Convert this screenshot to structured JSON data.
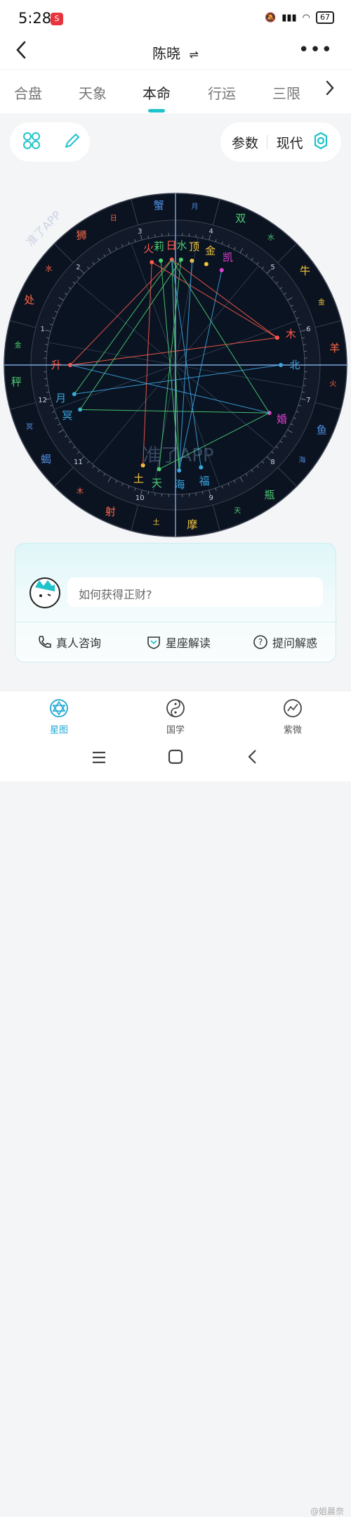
{
  "status": {
    "time": "5:28",
    "battery": "67",
    "app_badge": "S"
  },
  "header": {
    "title": "陈晓",
    "swap_icon": "⇌"
  },
  "tabs": [
    {
      "label": "合盘"
    },
    {
      "label": "天象"
    },
    {
      "label": "本命"
    },
    {
      "label": "行运"
    },
    {
      "label": "三限"
    }
  ],
  "toolbar": {
    "params_label": "参数",
    "mode_label": "现代"
  },
  "chart": {
    "watermark": "准了APP",
    "accent": "#21c3cb",
    "signs": [
      {
        "name": "蟹",
        "ruler": "月"
      },
      {
        "name": "狮",
        "ruler": "日"
      },
      {
        "name": "处",
        "ruler": "水"
      },
      {
        "name": "秤",
        "ruler": "金"
      },
      {
        "name": "蝎",
        "ruler": "冥"
      },
      {
        "name": "射",
        "ruler": "木"
      },
      {
        "name": "摩",
        "ruler": "土"
      },
      {
        "name": "瓶",
        "ruler": "天"
      },
      {
        "name": "鱼",
        "ruler": "海"
      },
      {
        "name": "羊",
        "ruler": "火"
      },
      {
        "name": "牛",
        "ruler": "金"
      },
      {
        "name": "双",
        "ruler": "水"
      }
    ],
    "houses": [
      "1",
      "2",
      "3",
      "4",
      "5",
      "6",
      "7",
      "8",
      "9",
      "10",
      "11",
      "12"
    ],
    "planets": [
      {
        "name": "火",
        "color": "#ff5a4a"
      },
      {
        "name": "莉",
        "color": "#4ccf72"
      },
      {
        "name": "日",
        "color": "#ff5a4a"
      },
      {
        "name": "水",
        "color": "#4ccf72"
      },
      {
        "name": "顶",
        "color": "#f3c63c"
      },
      {
        "name": "金",
        "color": "#f3c63c"
      },
      {
        "name": "凯",
        "color": "#e040d0"
      },
      {
        "name": "木",
        "color": "#ff5a4a"
      },
      {
        "name": "北",
        "color": "#3aa6e0"
      },
      {
        "name": "婚",
        "color": "#e040d0"
      },
      {
        "name": "福",
        "color": "#3aa6e0"
      },
      {
        "name": "海",
        "color": "#3aa6e0"
      },
      {
        "name": "天",
        "color": "#4ccf72"
      },
      {
        "name": "土",
        "color": "#f3c63c"
      },
      {
        "name": "冥",
        "color": "#3aa6e0"
      },
      {
        "name": "月",
        "color": "#3aa6e0"
      },
      {
        "name": "升",
        "color": "#ff5a4a"
      }
    ]
  },
  "assistant": {
    "question": "如何获得正财?"
  },
  "actions": [
    {
      "label": "真人咨询",
      "icon": "phone-icon"
    },
    {
      "label": "星座解读",
      "icon": "shield-icon"
    },
    {
      "label": "提问解惑",
      "icon": "question-icon"
    }
  ],
  "bottom_nav": [
    {
      "label": "星图",
      "icon": "star-of-david-icon",
      "active": true
    },
    {
      "label": "国学",
      "icon": "yin-yang-icon",
      "active": false
    },
    {
      "label": "紫微",
      "icon": "chart-line-icon",
      "active": false
    }
  ],
  "footer_watermark": "@姐晨奈"
}
